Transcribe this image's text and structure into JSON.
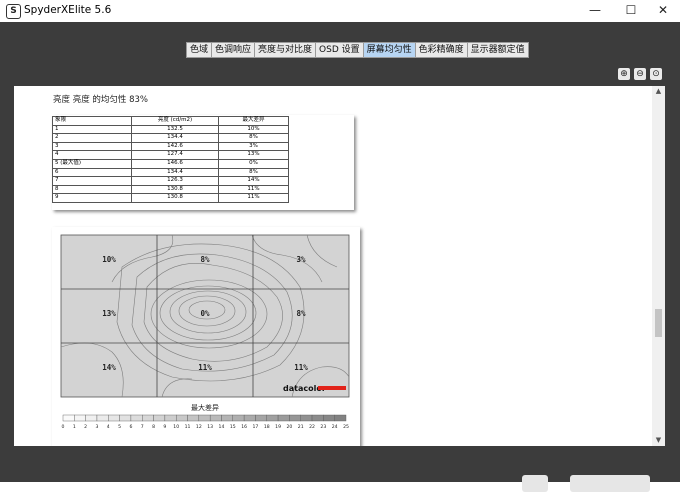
{
  "window": {
    "title": "SpyderXElite 5.6",
    "icon_letter": "S",
    "minimize_glyph": "—",
    "maximize_glyph": "☐",
    "close_glyph": "✕"
  },
  "tabs": [
    {
      "label": "色域",
      "active": false
    },
    {
      "label": "色调响应",
      "active": false
    },
    {
      "label": "亮度与对比度",
      "active": false
    },
    {
      "label": "OSD 设置",
      "active": false
    },
    {
      "label": "屏幕均匀性",
      "active": true
    },
    {
      "label": "色彩精确度",
      "active": false
    },
    {
      "label": "显示器额定值",
      "active": false
    }
  ],
  "zoom_buttons": [
    {
      "name": "zoom-in-icon",
      "glyph": "⊕"
    },
    {
      "name": "zoom-out-icon",
      "glyph": "⊖"
    },
    {
      "name": "zoom-fit-icon",
      "glyph": "⊙"
    }
  ],
  "report": {
    "heading": "亮度 亮度 的均匀性 83%",
    "table": {
      "headers": [
        "象限",
        "亮度 (cd/m2)",
        "最大差异"
      ],
      "rows": [
        [
          "1",
          "132.5",
          "10%"
        ],
        [
          "2",
          "134.4",
          "8%"
        ],
        [
          "3",
          "142.6",
          "3%"
        ],
        [
          "4",
          "127.4",
          "13%"
        ],
        [
          "5 (最大值)",
          "146.6",
          "0%"
        ],
        [
          "6",
          "134.4",
          "8%"
        ],
        [
          "7",
          "126.3",
          "14%"
        ],
        [
          "8",
          "130.8",
          "11%"
        ],
        [
          "9",
          "130.8",
          "11%"
        ]
      ]
    },
    "map": {
      "cells": [
        "10%",
        "8%",
        "3%",
        "13%",
        "0%",
        "8%",
        "14%",
        "11%",
        "11%"
      ],
      "logo_text": "datacolor",
      "logo_color": "#e2231a",
      "legend_title": "最大差异",
      "legend_ticks": [
        "0",
        "1",
        "2",
        "3",
        "4",
        "5",
        "6",
        "7",
        "8",
        "9",
        "10",
        "11",
        "12",
        "13",
        "14",
        "15",
        "16",
        "17",
        "18",
        "19",
        "20",
        "21",
        "22",
        "23",
        "24",
        "25"
      ]
    }
  },
  "colors": {
    "frame": "#3c3c3c",
    "active_tab": "#b7d5f3",
    "map_bg": "#d3d3d3"
  }
}
